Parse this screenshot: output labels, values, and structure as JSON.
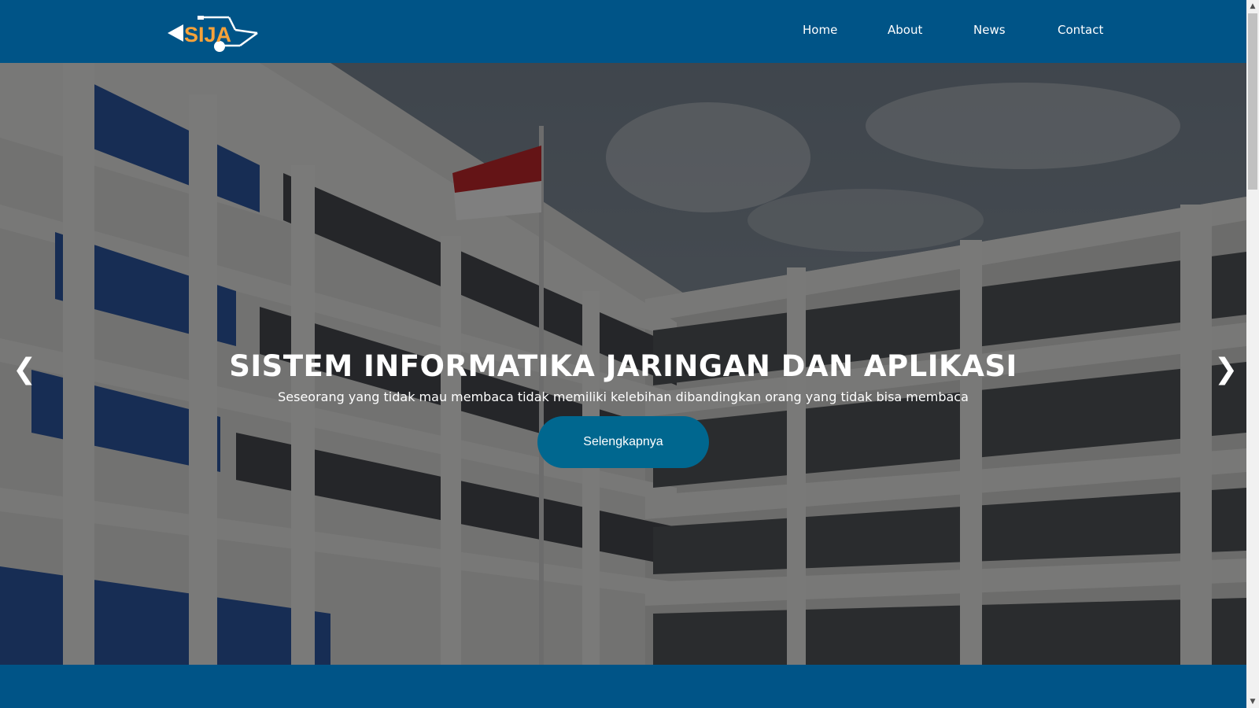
{
  "brand": {
    "logo_text": "SIJA"
  },
  "nav": {
    "items": [
      {
        "label": "Home"
      },
      {
        "label": "About"
      },
      {
        "label": "News"
      },
      {
        "label": "Contact"
      }
    ]
  },
  "hero": {
    "title": "SISTEM INFORMATIKA JARINGAN DAN APLIKASI",
    "subtitle": "Seseorang yang tidak mau membaca tidak memiliki kelebihan dibandingkan orang yang tidak bisa membaca",
    "cta_label": "Selengkapnya",
    "prev_arrow": "❮",
    "next_arrow": "❯"
  },
  "colors": {
    "nav_bg": "#005487",
    "cta_bg": "#00678f",
    "logo_accent": "#f6a23a",
    "text": "#ffffff"
  },
  "icons": {
    "logo": "sija-circuit-logo",
    "prev": "chevron-left-icon",
    "next": "chevron-right-icon",
    "scroll_up": "scroll-up-arrow-icon",
    "scroll_down": "scroll-down-arrow-icon"
  }
}
